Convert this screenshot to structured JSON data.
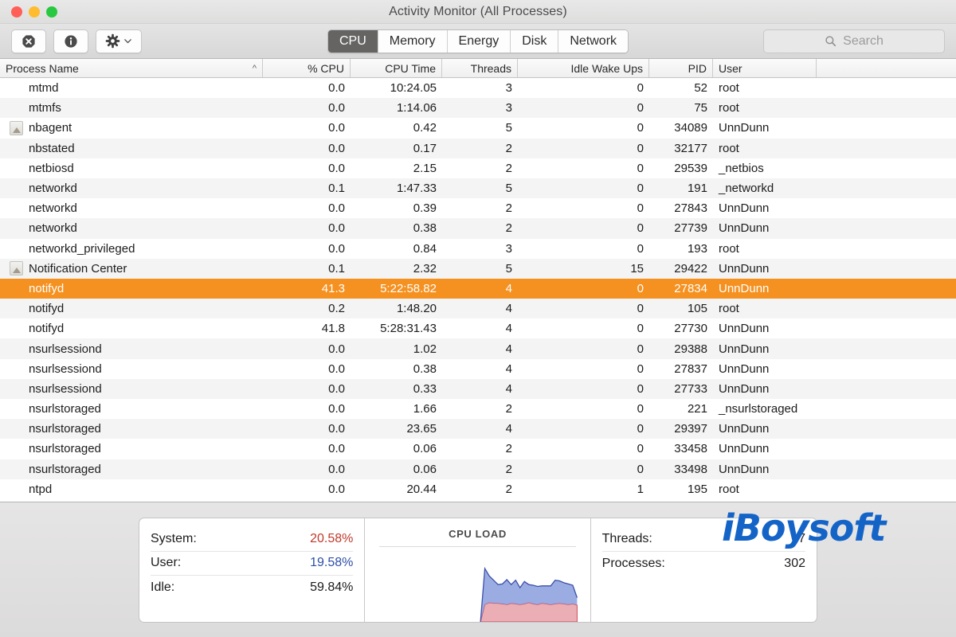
{
  "window": {
    "title": "Activity Monitor (All Processes)",
    "traffic_lights": [
      "close",
      "minimize",
      "zoom"
    ]
  },
  "toolbar": {
    "quit_process_label": "",
    "inspect_label": "",
    "settings_label": "",
    "icons": [
      "stop-quit-icon",
      "info-icon",
      "gear-icon",
      "chevron-down-icon"
    ],
    "tabs": [
      {
        "label": "CPU",
        "active": true
      },
      {
        "label": "Memory",
        "active": false
      },
      {
        "label": "Energy",
        "active": false
      },
      {
        "label": "Disk",
        "active": false
      },
      {
        "label": "Network",
        "active": false
      }
    ],
    "search": {
      "placeholder": "Search",
      "value": "",
      "icon": "search-icon"
    }
  },
  "table": {
    "columns": [
      {
        "key": "name",
        "label": "Process Name",
        "align": "left",
        "sort": "ascending"
      },
      {
        "key": "cpu",
        "label": "% CPU",
        "align": "right"
      },
      {
        "key": "time",
        "label": "CPU Time",
        "align": "right"
      },
      {
        "key": "threads",
        "label": "Threads",
        "align": "right"
      },
      {
        "key": "idle",
        "label": "Idle Wake Ups",
        "align": "right"
      },
      {
        "key": "pid",
        "label": "PID",
        "align": "right"
      },
      {
        "key": "user",
        "label": "User",
        "align": "left"
      }
    ],
    "rows": [
      {
        "name": "mtmd",
        "cpu": "0.0",
        "time": "10:24.05",
        "threads": "3",
        "idle": "0",
        "pid": "52",
        "user": "root",
        "icon": false,
        "selected": false
      },
      {
        "name": "mtmfs",
        "cpu": "0.0",
        "time": "1:14.06",
        "threads": "3",
        "idle": "0",
        "pid": "75",
        "user": "root",
        "icon": false,
        "selected": false
      },
      {
        "name": "nbagent",
        "cpu": "0.0",
        "time": "0.42",
        "threads": "5",
        "idle": "0",
        "pid": "34089",
        "user": "UnnDunn",
        "icon": true,
        "selected": false
      },
      {
        "name": "nbstated",
        "cpu": "0.0",
        "time": "0.17",
        "threads": "2",
        "idle": "0",
        "pid": "32177",
        "user": "root",
        "icon": false,
        "selected": false
      },
      {
        "name": "netbiosd",
        "cpu": "0.0",
        "time": "2.15",
        "threads": "2",
        "idle": "0",
        "pid": "29539",
        "user": "_netbios",
        "icon": false,
        "selected": false
      },
      {
        "name": "networkd",
        "cpu": "0.1",
        "time": "1:47.33",
        "threads": "5",
        "idle": "0",
        "pid": "191",
        "user": "_networkd",
        "icon": false,
        "selected": false
      },
      {
        "name": "networkd",
        "cpu": "0.0",
        "time": "0.39",
        "threads": "2",
        "idle": "0",
        "pid": "27843",
        "user": "UnnDunn",
        "icon": false,
        "selected": false
      },
      {
        "name": "networkd",
        "cpu": "0.0",
        "time": "0.38",
        "threads": "2",
        "idle": "0",
        "pid": "27739",
        "user": "UnnDunn",
        "icon": false,
        "selected": false
      },
      {
        "name": "networkd_privileged",
        "cpu": "0.0",
        "time": "0.84",
        "threads": "3",
        "idle": "0",
        "pid": "193",
        "user": "root",
        "icon": false,
        "selected": false
      },
      {
        "name": "Notification Center",
        "cpu": "0.1",
        "time": "2.32",
        "threads": "5",
        "idle": "15",
        "pid": "29422",
        "user": "UnnDunn",
        "icon": true,
        "selected": false
      },
      {
        "name": "notifyd",
        "cpu": "41.3",
        "time": "5:22:58.82",
        "threads": "4",
        "idle": "0",
        "pid": "27834",
        "user": "UnnDunn",
        "icon": false,
        "selected": true
      },
      {
        "name": "notifyd",
        "cpu": "0.2",
        "time": "1:48.20",
        "threads": "4",
        "idle": "0",
        "pid": "105",
        "user": "root",
        "icon": false,
        "selected": false
      },
      {
        "name": "notifyd",
        "cpu": "41.8",
        "time": "5:28:31.43",
        "threads": "4",
        "idle": "0",
        "pid": "27730",
        "user": "UnnDunn",
        "icon": false,
        "selected": false
      },
      {
        "name": "nsurlsessiond",
        "cpu": "0.0",
        "time": "1.02",
        "threads": "4",
        "idle": "0",
        "pid": "29388",
        "user": "UnnDunn",
        "icon": false,
        "selected": false
      },
      {
        "name": "nsurlsessiond",
        "cpu": "0.0",
        "time": "0.38",
        "threads": "4",
        "idle": "0",
        "pid": "27837",
        "user": "UnnDunn",
        "icon": false,
        "selected": false
      },
      {
        "name": "nsurlsessiond",
        "cpu": "0.0",
        "time": "0.33",
        "threads": "4",
        "idle": "0",
        "pid": "27733",
        "user": "UnnDunn",
        "icon": false,
        "selected": false
      },
      {
        "name": "nsurlstoraged",
        "cpu": "0.0",
        "time": "1.66",
        "threads": "2",
        "idle": "0",
        "pid": "221",
        "user": "_nsurlstoraged",
        "icon": false,
        "selected": false
      },
      {
        "name": "nsurlstoraged",
        "cpu": "0.0",
        "time": "23.65",
        "threads": "4",
        "idle": "0",
        "pid": "29397",
        "user": "UnnDunn",
        "icon": false,
        "selected": false
      },
      {
        "name": "nsurlstoraged",
        "cpu": "0.0",
        "time": "0.06",
        "threads": "2",
        "idle": "0",
        "pid": "33458",
        "user": "UnnDunn",
        "icon": false,
        "selected": false
      },
      {
        "name": "nsurlstoraged",
        "cpu": "0.0",
        "time": "0.06",
        "threads": "2",
        "idle": "0",
        "pid": "33498",
        "user": "UnnDunn",
        "icon": false,
        "selected": false
      },
      {
        "name": "ntpd",
        "cpu": "0.0",
        "time": "20.44",
        "threads": "2",
        "idle": "1",
        "pid": "195",
        "user": "root",
        "icon": false,
        "selected": false
      }
    ]
  },
  "footer": {
    "cpu_stats": [
      {
        "label": "System:",
        "value": "20.58%",
        "color_class": "system"
      },
      {
        "label": "User:",
        "value": "19.58%",
        "color_class": "user"
      },
      {
        "label": "Idle:",
        "value": "59.84%",
        "color_class": "plain"
      }
    ],
    "graph": {
      "title": "CPU LOAD"
    },
    "counts": [
      {
        "label": "Threads:",
        "value": "7"
      },
      {
        "label": "Processes:",
        "value": "302"
      }
    ]
  },
  "watermark": {
    "text": "iBoysoft",
    "color": "#1464c8"
  },
  "chart_data": {
    "type": "area",
    "title": "CPU LOAD",
    "stacked": true,
    "xlabel": "",
    "ylabel": "",
    "ylim": [
      0,
      100
    ],
    "grid": false,
    "legend_position": "none",
    "x": [
      0,
      1,
      2,
      3,
      4,
      5,
      6,
      7,
      8,
      9,
      10,
      11,
      12,
      13,
      14,
      15,
      16,
      17,
      18,
      19,
      20,
      21,
      22
    ],
    "series": [
      {
        "name": "System",
        "color": "#e8a0a8",
        "values": [
          0,
          28,
          31,
          30,
          30,
          29,
          28,
          30,
          29,
          28,
          29,
          31,
          29,
          28,
          30,
          29,
          28,
          29,
          30,
          29,
          28,
          29,
          27
        ]
      },
      {
        "name": "User",
        "color": "#8a9ede",
        "values": [
          0,
          58,
          43,
          37,
          30,
          32,
          40,
          30,
          38,
          27,
          36,
          29,
          30,
          29,
          28,
          29,
          30,
          38,
          36,
          34,
          33,
          30,
          12
        ]
      }
    ]
  }
}
